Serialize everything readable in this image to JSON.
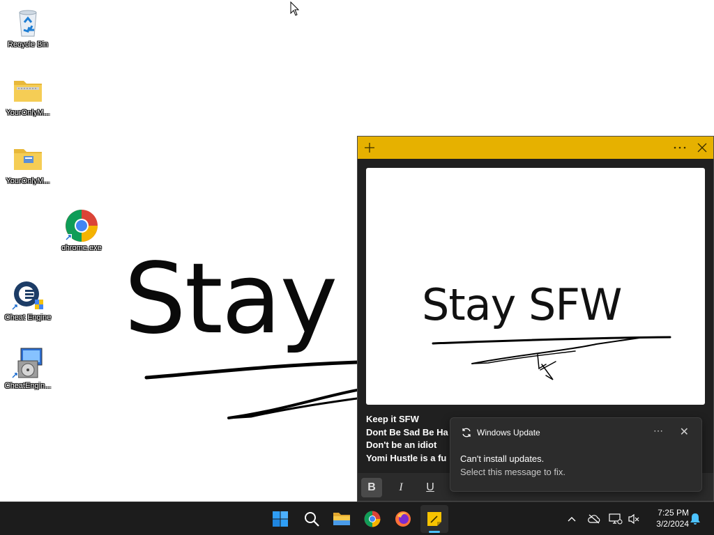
{
  "desktop": {
    "wallpaper_text": "Stay S",
    "icons": [
      {
        "label": "Recycle Bin",
        "icon": "recycle-bin-icon"
      },
      {
        "label": "YourOnlyM...",
        "icon": "zip-folder-icon"
      },
      {
        "label": "YourOnlyM...",
        "icon": "folder-icon"
      },
      {
        "label": "chrome.exe",
        "icon": "chrome-icon"
      },
      {
        "label": "Cheat Engine",
        "icon": "cheat-engine-icon"
      },
      {
        "label": "CheatEngin...",
        "icon": "installer-icon"
      }
    ]
  },
  "sticky_note": {
    "app": "Sticky Notes",
    "accent": "#e6b100",
    "image_text": "Stay SFW",
    "lines": [
      "Keep it SFW",
      "Dont Be Sad Be Ha",
      "Don't be an idiot",
      "Yomi Hustle is a fu"
    ],
    "format": {
      "bold": "B",
      "italic": "I",
      "underline": "U"
    }
  },
  "toast": {
    "title": "Windows Update",
    "line1": "Can't install updates.",
    "line2": "Select this message to fix."
  },
  "taskbar": {
    "apps": [
      "start-icon",
      "search-icon",
      "file-explorer-icon",
      "chrome-icon",
      "firefox-icon",
      "sticky-notes-icon"
    ],
    "time": "7:25 PM",
    "date": "3/2/2024"
  }
}
